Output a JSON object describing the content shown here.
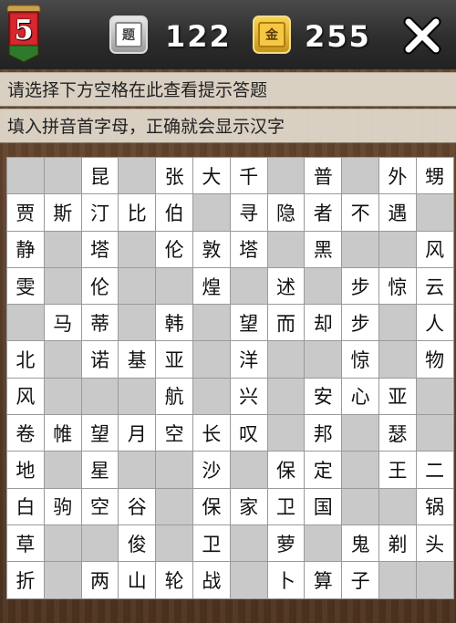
{
  "header": {
    "level": "5",
    "questions_icon_char": "题",
    "questions_count": "122",
    "gold_icon_char": "金",
    "gold_count": "255",
    "close_icon": "close-icon"
  },
  "hints": {
    "line1": "请选择下方空格在此查看提示答题",
    "line2": "填入拼音首字母，正确就会显示汉字"
  },
  "grid": {
    "rows": [
      [
        "#",
        "#",
        "昆",
        "#",
        "张",
        "大",
        "千",
        "#",
        "普",
        "#",
        "外",
        "甥"
      ],
      [
        "贾",
        "斯",
        "汀",
        "比",
        "伯",
        "#",
        "寻",
        "隐",
        "者",
        "不",
        "遇",
        "#"
      ],
      [
        "静",
        "#",
        "塔",
        "#",
        "伦",
        "敦",
        "塔",
        "#",
        "黑",
        "#",
        "#",
        "风"
      ],
      [
        "雯",
        "#",
        "伦",
        "#",
        "#",
        "煌",
        "#",
        "述",
        "#",
        "步",
        "惊",
        "云"
      ],
      [
        "#",
        "马",
        "蒂",
        "#",
        "韩",
        "#",
        "望",
        "而",
        "却",
        "步",
        "#",
        "人"
      ],
      [
        "北",
        "#",
        "诺",
        "基",
        "亚",
        "#",
        "洋",
        "#",
        "#",
        "惊",
        "#",
        "物"
      ],
      [
        "风",
        "#",
        "#",
        "#",
        "航",
        "#",
        "兴",
        "#",
        "安",
        "心",
        "亚",
        "#"
      ],
      [
        "卷",
        "帷",
        "望",
        "月",
        "空",
        "长",
        "叹",
        "#",
        "邦",
        "#",
        "瑟",
        "#"
      ],
      [
        "地",
        "#",
        "星",
        "#",
        "#",
        "沙",
        "#",
        "保",
        "定",
        "#",
        "王",
        "二"
      ],
      [
        "白",
        "驹",
        "空",
        "谷",
        "#",
        "保",
        "家",
        "卫",
        "国",
        "#",
        "#",
        "锅"
      ],
      [
        "草",
        "#",
        "#",
        "俊",
        "#",
        "卫",
        "#",
        "萝",
        "#",
        "鬼",
        "剃",
        "头"
      ],
      [
        "折",
        "#",
        "两",
        "山",
        "轮",
        "战",
        "#",
        "卜",
        "算",
        "子",
        "#",
        "#"
      ]
    ]
  },
  "colors": {
    "blocked_cell": "#c9c9c9",
    "open_cell": "#ffffff",
    "hint_bar": "#e2dacd",
    "badge_red": "#c02025",
    "badge_green": "#2f7a2a"
  }
}
